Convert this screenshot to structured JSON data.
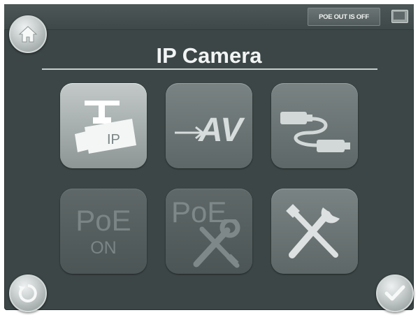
{
  "header": {
    "poe_status": "POE OUT IS OFF",
    "battery_icon": "battery-icon",
    "home_icon": "home-icon"
  },
  "page": {
    "title": "IP Camera"
  },
  "tiles": [
    {
      "icon": "ip-camera-icon",
      "text": "IP",
      "state": "selected"
    },
    {
      "icon": "av-icon",
      "text": "AV"
    },
    {
      "icon": "cable-icon"
    },
    {
      "icon": "poe-on-icon",
      "line1": "PoE",
      "line2": "ON",
      "state": "disabled"
    },
    {
      "icon": "poe-tools-icon",
      "text": "PoE",
      "state": "disabled"
    },
    {
      "icon": "tools-icon"
    }
  ],
  "footer": {
    "back_icon": "refresh-icon",
    "confirm_icon": "check-icon"
  },
  "colors": {
    "screen_bg": "#3c4646",
    "tile": "#6b7474",
    "tile_selected": "#a9b0b0",
    "text": "#f2f4f4"
  }
}
